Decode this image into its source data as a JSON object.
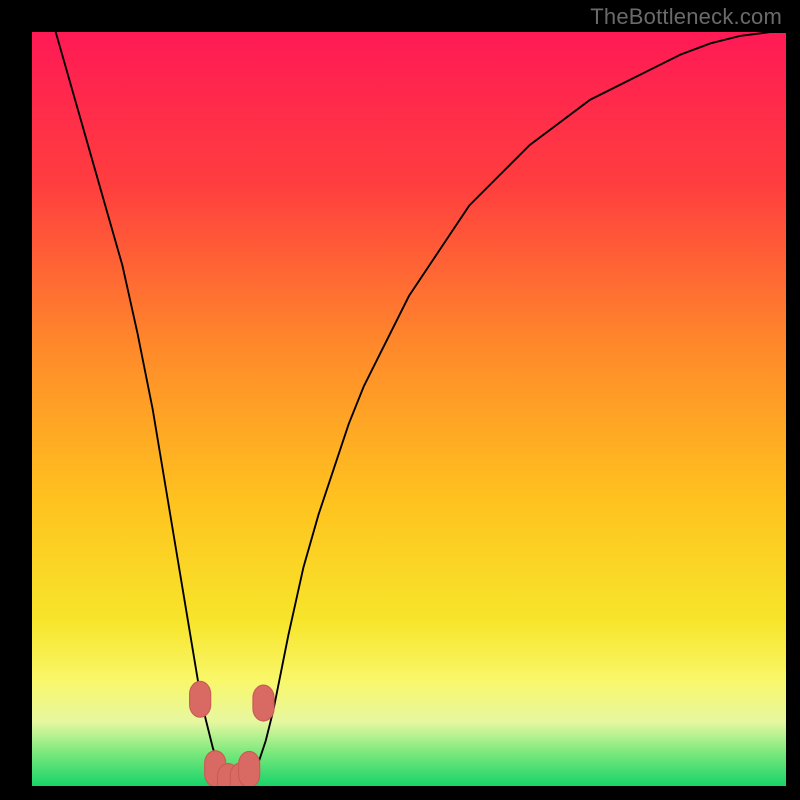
{
  "watermark": "TheBottleneck.com",
  "colors": {
    "frame": "#000000",
    "gradient_stops": [
      {
        "offset": 0.0,
        "color": "#ff1a55"
      },
      {
        "offset": 0.2,
        "color": "#ff3d3f"
      },
      {
        "offset": 0.42,
        "color": "#ff8a2a"
      },
      {
        "offset": 0.62,
        "color": "#ffc21f"
      },
      {
        "offset": 0.78,
        "color": "#f7e52a"
      },
      {
        "offset": 0.86,
        "color": "#f9f76a"
      },
      {
        "offset": 0.915,
        "color": "#e6f7a0"
      },
      {
        "offset": 0.955,
        "color": "#7de97d"
      },
      {
        "offset": 1.0,
        "color": "#17d36b"
      }
    ],
    "curve": "#000000",
    "marker_fill": "#d86a63",
    "marker_stroke": "#c95b55"
  },
  "chart_data": {
    "type": "line",
    "title": "",
    "xlabel": "",
    "ylabel": "",
    "xlim": [
      0,
      100
    ],
    "ylim": [
      0,
      100
    ],
    "grid": false,
    "legend": false,
    "x": [
      0,
      2,
      4,
      6,
      8,
      10,
      12,
      14,
      15,
      16,
      17,
      18,
      19,
      20,
      21,
      22,
      23,
      24,
      25,
      26,
      27,
      28,
      29,
      30,
      31,
      32,
      33,
      34,
      36,
      38,
      40,
      42,
      44,
      46,
      48,
      50,
      54,
      58,
      62,
      66,
      70,
      74,
      78,
      82,
      86,
      90,
      94,
      98,
      100
    ],
    "y": [
      110,
      104,
      97,
      90,
      83,
      76,
      69,
      60,
      55,
      50,
      44,
      38,
      32,
      26,
      20,
      14,
      9,
      5,
      2,
      0,
      0,
      0,
      1,
      3,
      6,
      10,
      15,
      20,
      29,
      36,
      42,
      48,
      53,
      57,
      61,
      65,
      71,
      77,
      81,
      85,
      88,
      91,
      93,
      95,
      97,
      98.5,
      99.5,
      100,
      100
    ],
    "markers": [
      {
        "x": 22.3,
        "y": 11.5
      },
      {
        "x": 24.3,
        "y": 2.3
      },
      {
        "x": 26.0,
        "y": 0.6
      },
      {
        "x": 27.7,
        "y": 0.7
      },
      {
        "x": 28.8,
        "y": 2.2
      },
      {
        "x": 30.7,
        "y": 11.0
      }
    ],
    "marker_radius": 2.8
  }
}
